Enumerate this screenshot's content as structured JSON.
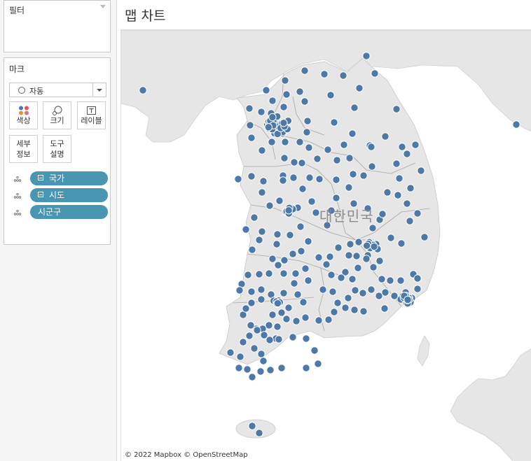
{
  "filters": {
    "title": "필터"
  },
  "marks": {
    "title": "마크",
    "mark_type": "자동",
    "buttons": {
      "color": "색상",
      "size": "크기",
      "label": "레이블",
      "detail": "세부\n정보",
      "tooltip": "도구\n설명"
    },
    "pills": [
      {
        "label": "국가",
        "kind": "dimension"
      },
      {
        "label": "시도",
        "kind": "dimension"
      },
      {
        "label": "시군구",
        "kind": "detail"
      }
    ]
  },
  "sheet": {
    "title": "맵 차트"
  },
  "map": {
    "country_label": "대한민국",
    "attribution": "© 2022 Mapbox © OpenStreetMap",
    "mark_color": "#4e79a7",
    "land_color": "#e6e6e6",
    "mark_count": 219
  }
}
